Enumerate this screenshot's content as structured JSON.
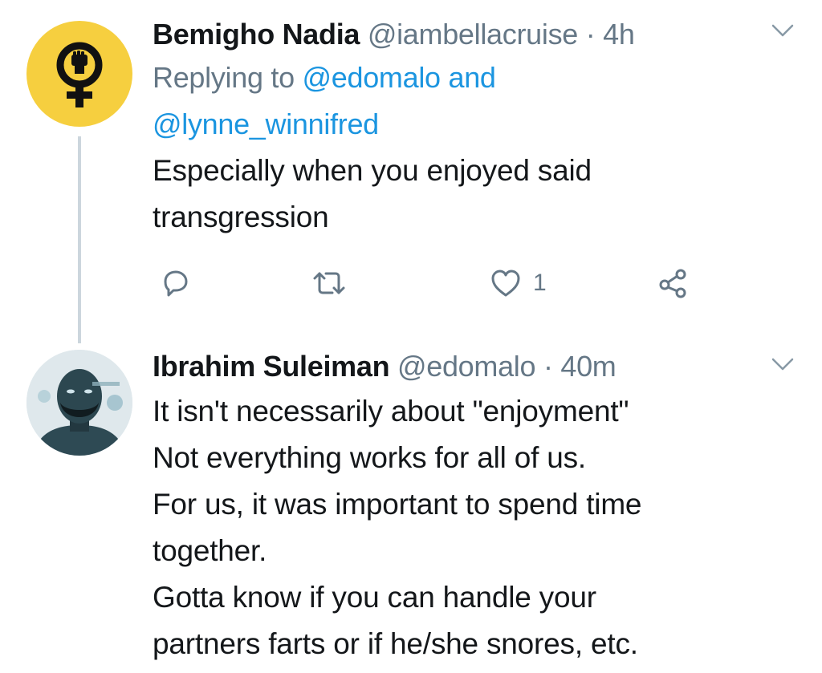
{
  "tweets": [
    {
      "author_name": "Bemigho Nadia",
      "handle": "@iambellacruise",
      "separator": "·",
      "time": "4h",
      "replying_label": "Replying to",
      "replying_mention_1": "@edomalo",
      "replying_conjunction": "and",
      "replying_mention_2": "@lynne_winnifred",
      "body_lines": [
        "Especially when you enjoyed said",
        "transgression"
      ],
      "actions": {
        "reply_icon": "reply-icon",
        "retweet_icon": "retweet-icon",
        "like_icon": "heart-icon",
        "like_count": "1",
        "share_icon": "share-icon"
      }
    },
    {
      "author_name": "Ibrahim Suleiman",
      "handle": "@edomalo",
      "separator": "·",
      "time": "40m",
      "body_lines": [
        "It isn't necessarily about \"enjoyment\"",
        "Not everything works for all of us.",
        "For us, it was important to spend time",
        "together.",
        "Gotta know if you can handle your",
        "partners farts or if he/she snores, etc."
      ]
    }
  ],
  "colors": {
    "text_primary": "#14171a",
    "text_secondary": "#657786",
    "link": "#1b95e0",
    "avatar_yellow": "#f6cf3f",
    "thread_line": "#ccd6dd"
  }
}
